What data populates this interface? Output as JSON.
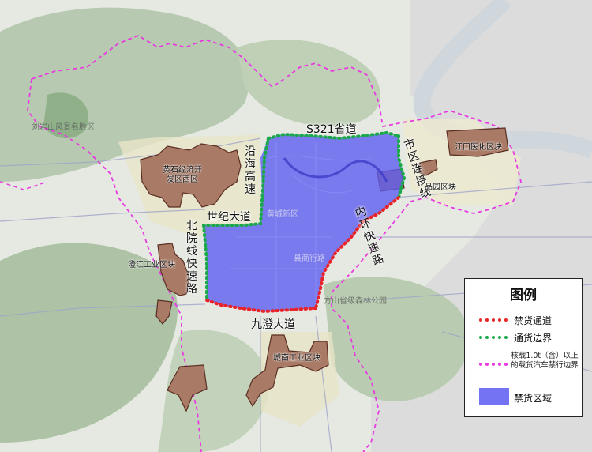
{
  "map": {
    "legend": {
      "title": "图例",
      "items": [
        {
          "label": "禁货通道",
          "color": "#e8242a"
        },
        {
          "label": "通货边界",
          "color": "#1aa84a"
        },
        {
          "label": "核载1.0t（含）以上的载货汽车禁行边界",
          "color": "#e83ae0"
        },
        {
          "label": "禁货区域",
          "color": "#5b5bf2"
        }
      ]
    },
    "roads": {
      "s321": "S321省道",
      "yanhai": "沿海高速",
      "shiji": "世纪大道",
      "beiyuan": "北院线快速路",
      "shiqu": "市区连接线",
      "neihuan": "内环快速路",
      "jiucheng": "九澄大道"
    },
    "zones": {
      "huangshi": "黄石经济开发区西区",
      "chengjiang": "澄江工业区块",
      "jiangkou": "江口医化区块",
      "pinyuan": "品园区块",
      "chengnan": "城南工业区块"
    },
    "places": {
      "liuyan": "刘岩山风景名胜区",
      "forest": "方山省级森林公园",
      "center": "黄城新区",
      "xianlu": "县商行路"
    },
    "colors": {
      "restricted": "#5b5bf2",
      "industrial": "#a97a66",
      "green_line": "#1aa84a",
      "red_line": "#e8242a",
      "magenta_line": "#e83ae0"
    }
  }
}
